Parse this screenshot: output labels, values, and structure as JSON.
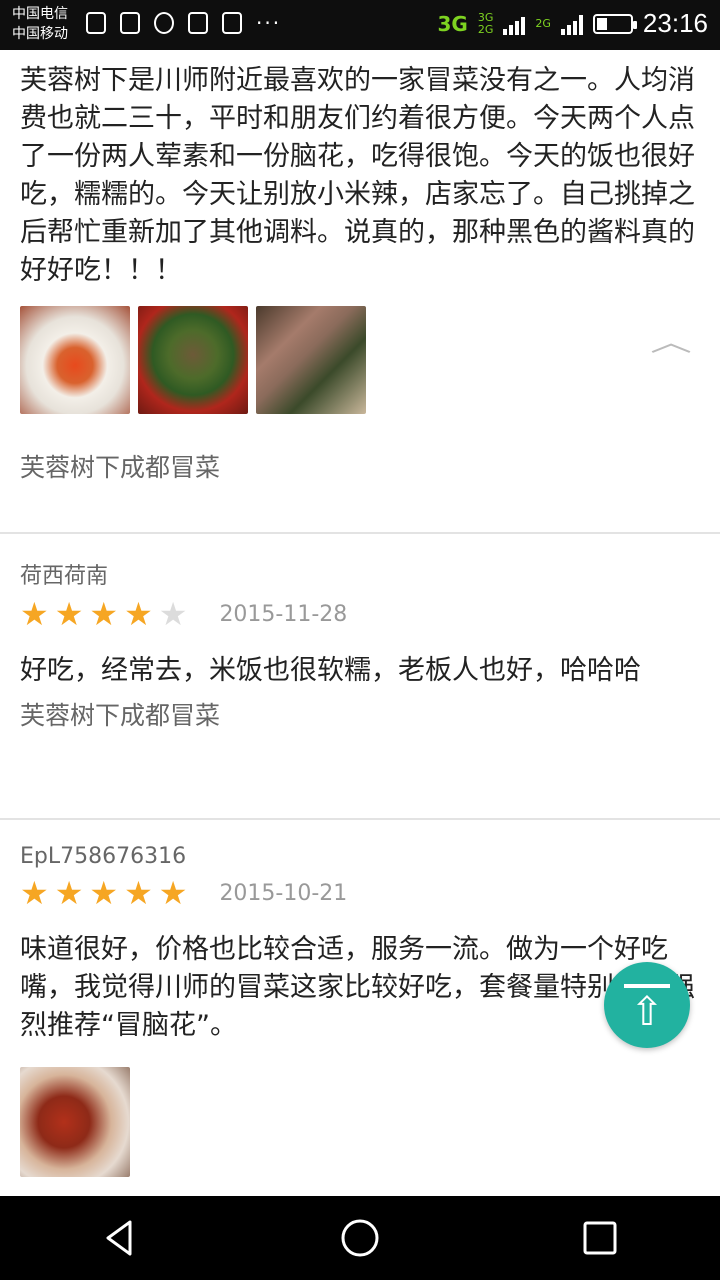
{
  "status_bar": {
    "carrier1": "中国电信",
    "carrier2": "中国移动",
    "network1": "3G",
    "network2_top": "3G",
    "network2_bottom": "2G",
    "network3": "2G",
    "time": "23:16",
    "more": "···"
  },
  "reviews": [
    {
      "body": "芙蓉树下是川师附近最喜欢的一家冒菜没有之一。人均消费也就二三十，平时和朋友们约着很方便。今天两个人点了一份两人荤素和一份脑花，吃得很饱。今天的饭也很好吃，糯糯的。今天让别放小米辣，店家忘了。自己挑掉之后帮忙重新加了其他调料。说真的，那种黑色的酱料真的好好吃！！！",
      "photo_count": 3,
      "shop": "芙蓉树下成都冒菜"
    },
    {
      "user": "荷西荷南",
      "rating": 4,
      "date": "2015-11-28",
      "body": "好吃，经常去，米饭也很软糯，老板人也好，哈哈哈",
      "shop": "芙蓉树下成都冒菜"
    },
    {
      "user": "EpL758676316",
      "rating": 5,
      "date": "2015-10-21",
      "body": "味道很好，价格也比较合适，服务一流。做为一个好吃嘴，我觉得川师的冒菜这家比较好吃，套餐量特别足，强烈推荐“冒脑花”。",
      "photo_count": 1
    }
  ],
  "icons": {
    "collapse": "chevron-up-icon",
    "back_to_top": "back-to-top-icon",
    "nav_back": "back-triangle-icon",
    "nav_home": "home-circle-icon",
    "nav_recents": "recents-square-icon"
  },
  "colors": {
    "star": "#f6a623",
    "star_empty": "#dcdcdc",
    "back_to_top": "#22b2a0",
    "net_green": "#7ed321"
  }
}
